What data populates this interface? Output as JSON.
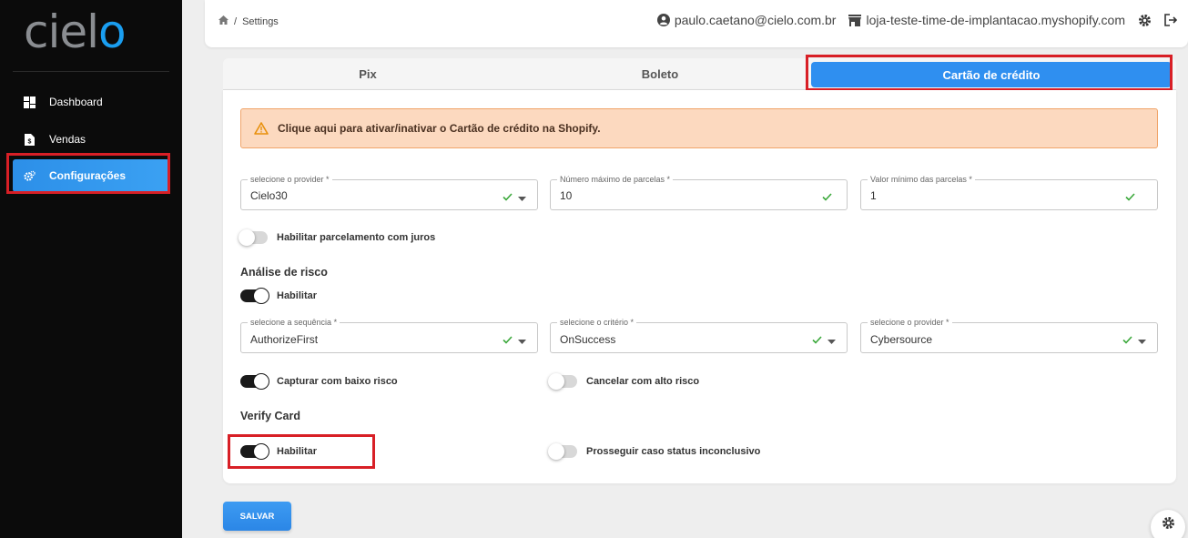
{
  "sidebar": {
    "logo_text": "cielo",
    "items": [
      {
        "label": "Dashboard",
        "icon": "dashboard-icon"
      },
      {
        "label": "Vendas",
        "icon": "document-icon"
      },
      {
        "label": "Configurações",
        "icon": "gears-icon"
      }
    ]
  },
  "header": {
    "breadcrumb_current": "Settings",
    "user_email": "paulo.caetano@cielo.com.br",
    "store": "loja-teste-time-de-implantacao.myshopify.com"
  },
  "tabs": [
    "Pix",
    "Boleto",
    "Cartão de crédito"
  ],
  "alert": {
    "text": "Clique aqui para ativar/inativar o Cartão de crédito na Shopify."
  },
  "fields_row1": [
    {
      "label": "selecione o provider *",
      "value": "Cielo30"
    },
    {
      "label": "Número máximo de parcelas *",
      "value": "10"
    },
    {
      "label": "Valor mínimo das parcelas *",
      "value": "1"
    }
  ],
  "toggle_juros": {
    "label": "Habilitar parcelamento com juros"
  },
  "risk": {
    "title": "Análise de risco",
    "enable_label": "Habilitar",
    "fields": [
      {
        "label": "selecione a sequência *",
        "value": "AuthorizeFirst"
      },
      {
        "label": "selecione o critério *",
        "value": "OnSuccess"
      },
      {
        "label": "selecione o provider *",
        "value": "Cybersource"
      }
    ],
    "capture_label": "Capturar com baixo risco",
    "cancel_label": "Cancelar com alto risco"
  },
  "verify": {
    "title": "Verify Card",
    "enable_label": "Habilitar",
    "proceed_label": "Prosseguir caso status inconclusivo"
  },
  "save_label": "SALVAR",
  "colors": {
    "accent": "#2f8ff0",
    "sidebar_bg": "#0b0b0b",
    "alert_bg": "#fcd9bf",
    "highlight": "#d81f26",
    "check": "#3aa83a"
  }
}
